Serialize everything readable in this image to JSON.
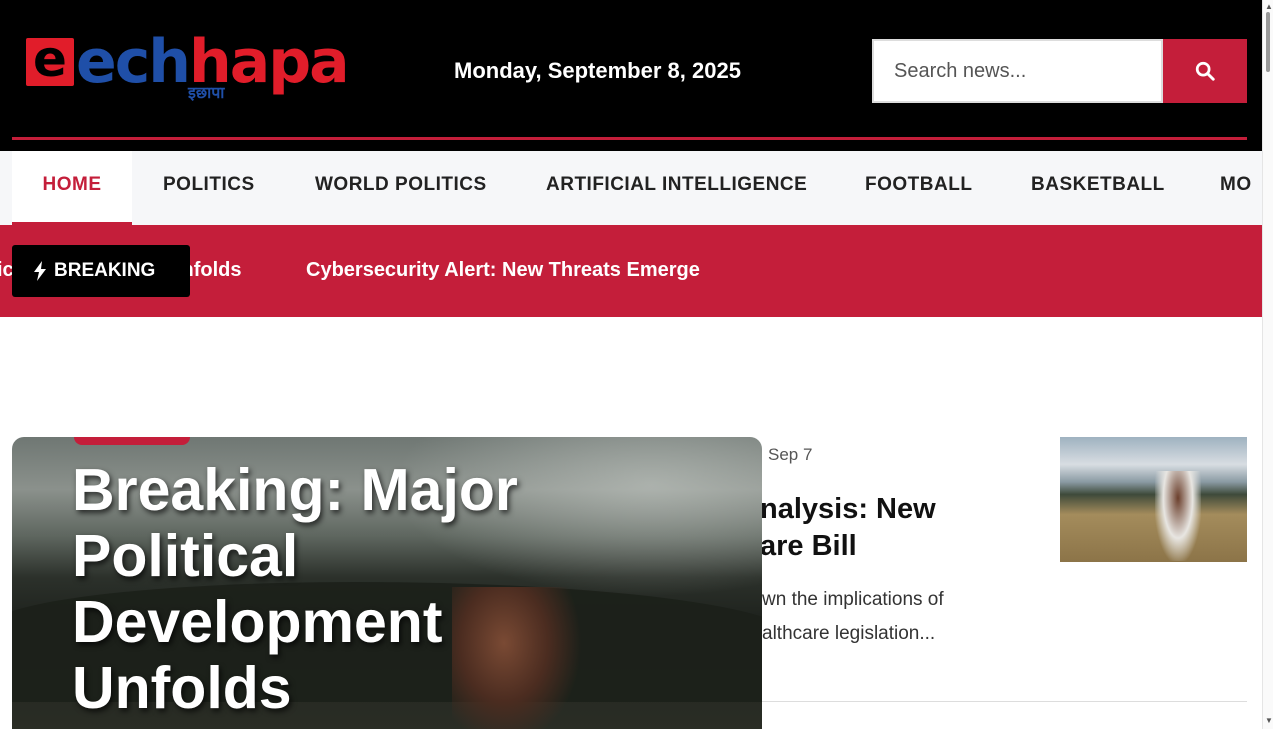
{
  "brand": {
    "logo_e": "e",
    "logo_part1": "ech",
    "logo_part2": "hapa",
    "logo_sub": "इछापा"
  },
  "header": {
    "date": "Monday, September 8, 2025",
    "search_placeholder": "Search news...",
    "accent_color": "#c41e3a"
  },
  "nav": {
    "items": [
      {
        "label": "HOME",
        "active": true
      },
      {
        "label": "POLITICS"
      },
      {
        "label": "WORLD POLITICS"
      },
      {
        "label": "ARTIFICIAL INTELLIGENCE"
      },
      {
        "label": "FOOTBALL"
      },
      {
        "label": "BASKETBALL"
      },
      {
        "label": "MO"
      }
    ]
  },
  "ticker": {
    "label": "BREAKING",
    "items": [
      "ical Development Unfolds",
      "Cybersecurity Alert: New Threats Emerge"
    ]
  },
  "hero": {
    "title": "Breaking: Major Political Development Unfolds"
  },
  "side_article": {
    "date": "Sep 7",
    "title": "nalysis: New\nare Bill",
    "excerpt": "wn the implications of\nalthcare legislation..."
  }
}
